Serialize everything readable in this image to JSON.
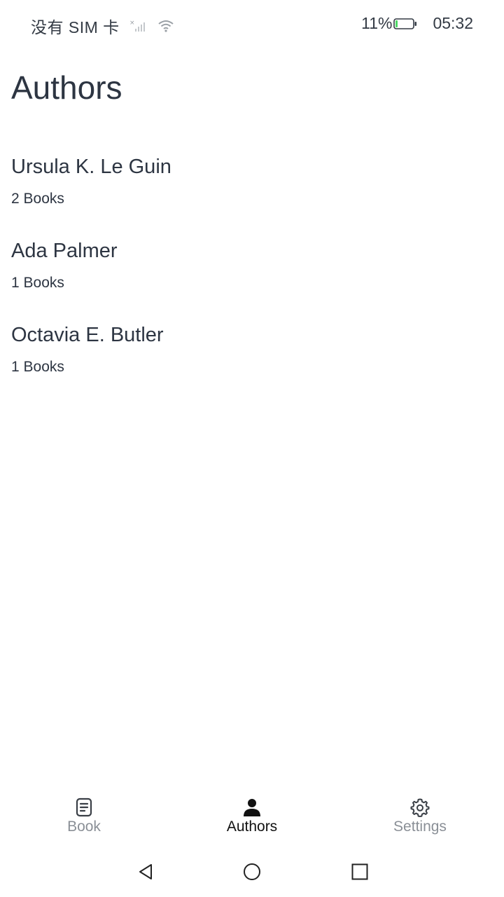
{
  "status_bar": {
    "carrier": "没有 SIM 卡",
    "battery_percent": "11%",
    "battery_level": 0.11,
    "time": "05:32"
  },
  "page": {
    "title": "Authors"
  },
  "authors": [
    {
      "name": "Ursula K. Le Guin",
      "count": "2 Books"
    },
    {
      "name": "Ada Palmer",
      "count": "1 Books"
    },
    {
      "name": "Octavia E. Butler",
      "count": "1 Books"
    }
  ],
  "tabs": [
    {
      "label": "Book",
      "icon": "document-icon",
      "active": false
    },
    {
      "label": "Authors",
      "icon": "person-icon",
      "active": true
    },
    {
      "label": "Settings",
      "icon": "gear-icon",
      "active": false
    }
  ],
  "colors": {
    "active_tab": "#111111",
    "inactive_tab": "#8a8f96",
    "text": "#2d3542",
    "battery_fill": "#4cd964"
  }
}
